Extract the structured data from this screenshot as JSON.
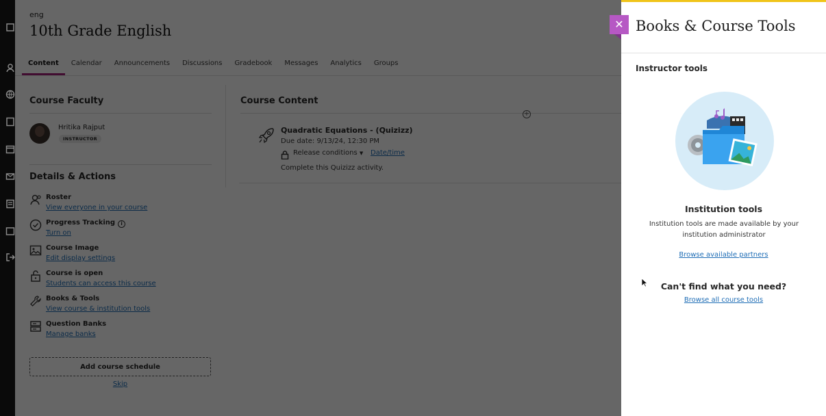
{
  "course": {
    "code": "eng",
    "title": "10th Grade English"
  },
  "tabs": [
    {
      "label": "Content",
      "active": true
    },
    {
      "label": "Calendar"
    },
    {
      "label": "Announcements"
    },
    {
      "label": "Discussions"
    },
    {
      "label": "Gradebook"
    },
    {
      "label": "Messages"
    },
    {
      "label": "Analytics"
    },
    {
      "label": "Groups"
    }
  ],
  "faculty": {
    "heading": "Course Faculty",
    "name": "Hritika Rajput",
    "role": "INSTRUCTOR"
  },
  "details": {
    "heading": "Details & Actions",
    "items": [
      {
        "icon": "roster-icon",
        "title": "Roster",
        "link": "View everyone in your course"
      },
      {
        "icon": "progress-check-icon",
        "title": "Progress Tracking",
        "link": "Turn on"
      },
      {
        "icon": "image-icon",
        "title": "Course Image",
        "link": "Edit display settings"
      },
      {
        "icon": "unlock-icon",
        "title": "Course is open",
        "link": "Students can access this course"
      },
      {
        "icon": "wrench-icon",
        "title": "Books & Tools",
        "link": "View course & institution tools"
      },
      {
        "icon": "question-bank-icon",
        "title": "Question Banks",
        "link": "Manage banks"
      }
    ],
    "add_schedule_label": "Add course schedule",
    "skip_label": "Skip"
  },
  "content": {
    "heading": "Course Content",
    "item": {
      "icon": "rocket-icon",
      "title": "Quadratic Equations - (Quizizz)",
      "due": "Due date: 9/13/24, 12:30 PM",
      "release_label": "Release conditions",
      "date_link": "Date/time",
      "description": "Complete this Quizizz activity."
    }
  },
  "panel": {
    "title": "Books & Course Tools",
    "close_icon": "close-icon",
    "accent_color": "#b658c4",
    "top_border_color": "#f0c419",
    "instructor_heading": "Instructor tools",
    "institution_heading": "Institution tools",
    "institution_desc": "Institution tools are made available by your institution administrator",
    "browse_partners": "Browse available partners",
    "cant_find": "Can't find what you need?",
    "browse_all": "Browse all course tools"
  },
  "colors": {
    "link": "#1d6cb5",
    "active_tab": "#a3217a"
  }
}
